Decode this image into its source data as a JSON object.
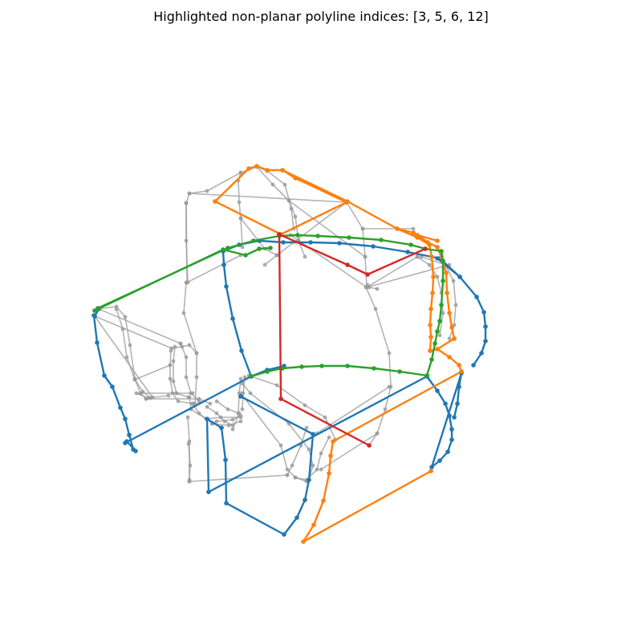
{
  "title": "Highlighted non-planar polyline indices: [3, 5, 6, 12]",
  "colors": {
    "background": "#ffffff",
    "gray": "#9a9a9a",
    "blue": "#1f77b4",
    "orange": "#ff7f0e",
    "green": "#2ca02c",
    "red": "#d62728"
  }
}
